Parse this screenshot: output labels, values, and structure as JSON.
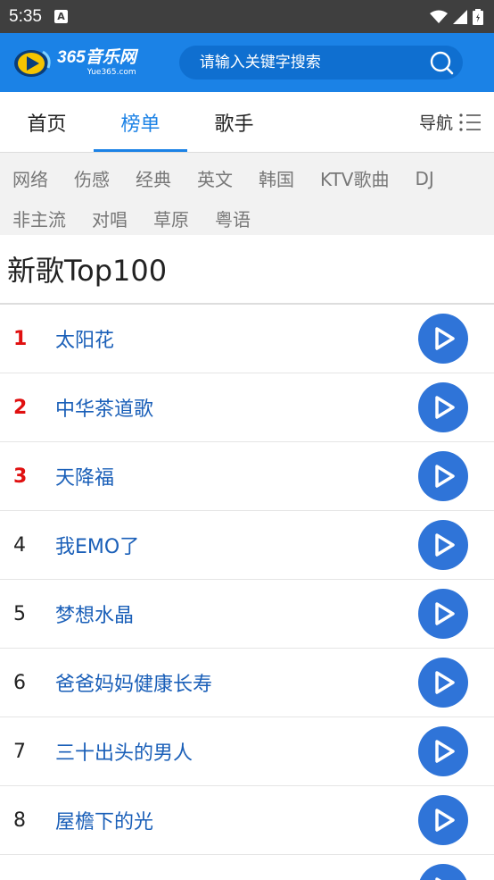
{
  "status_bar": {
    "time": "5:35",
    "badge": "A"
  },
  "header": {
    "logo_brand": "365音乐网",
    "logo_sub": "Yue365.com",
    "search_placeholder": "请输入关键字搜索"
  },
  "tabs": [
    {
      "label": "首页",
      "active": false
    },
    {
      "label": "榜单",
      "active": true
    },
    {
      "label": "歌手",
      "active": false
    }
  ],
  "nav_label": "导航",
  "categories_row1": [
    "网络",
    "伤感",
    "经典",
    "英文",
    "韩国",
    "KTV歌曲",
    "DJ"
  ],
  "categories_row2": [
    "非主流",
    "对唱",
    "草原",
    "粤语"
  ],
  "list_title": "新歌Top100",
  "songs": [
    {
      "rank": "1",
      "title": "太阳花"
    },
    {
      "rank": "2",
      "title": "中华茶道歌"
    },
    {
      "rank": "3",
      "title": "天降福"
    },
    {
      "rank": "4",
      "title": "我EMO了"
    },
    {
      "rank": "5",
      "title": "梦想水晶"
    },
    {
      "rank": "6",
      "title": "爸爸妈妈健康长寿"
    },
    {
      "rank": "7",
      "title": "三十出头的男人"
    },
    {
      "rank": "8",
      "title": "屋檐下的光"
    }
  ],
  "colors": {
    "header": "#1b82e6",
    "accent": "#1b82e6",
    "top_rank": "#e01010",
    "play": "#2f74d8"
  }
}
